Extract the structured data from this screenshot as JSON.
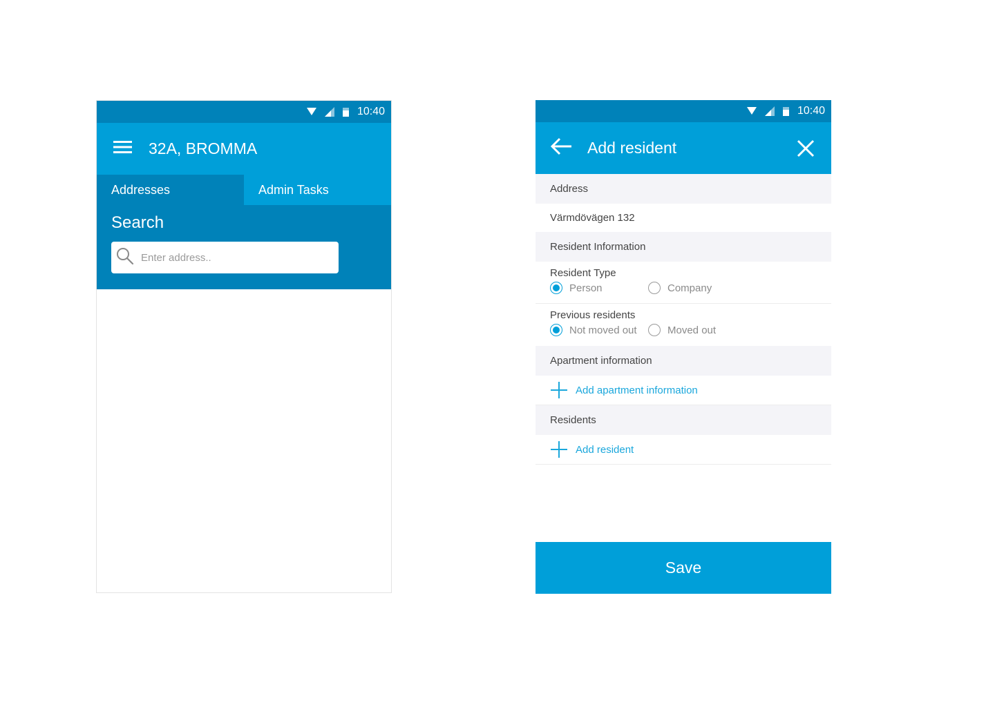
{
  "status_bar": {
    "time": "10:40"
  },
  "left_screen": {
    "app_bar": {
      "title": "32A, BROMMA",
      "menu_icon": "hamburger-menu-icon"
    },
    "tabs": [
      {
        "label": "Addresses",
        "active": true
      },
      {
        "label": "Admin Tasks",
        "active": false
      }
    ],
    "search": {
      "title": "Search",
      "placeholder": "Enter address..",
      "icon": "search-icon"
    }
  },
  "right_screen": {
    "app_bar": {
      "title": "Add resident",
      "back_icon": "arrow-left-icon",
      "close_icon": "close-icon"
    },
    "address": {
      "header": "Address",
      "value": "Värmdövägen 132"
    },
    "resident_information": {
      "header": "Resident Information",
      "resident_type": {
        "label": "Resident Type",
        "options": [
          "Person",
          "Company"
        ],
        "selected": "Person"
      },
      "previous_residents": {
        "label": "Previous residents",
        "options": [
          "Not moved out",
          "Moved out"
        ],
        "selected": "Not moved out"
      }
    },
    "apartment_information": {
      "header": "Apartment information",
      "add_label": "Add apartment information"
    },
    "residents": {
      "header": "Residents",
      "add_label": "Add resident"
    },
    "save_label": "Save"
  },
  "colors": {
    "primary": "#009fd9",
    "primary_dark": "#0082b9",
    "section_bg": "#f4f4f8",
    "link": "#1aa7dc"
  }
}
